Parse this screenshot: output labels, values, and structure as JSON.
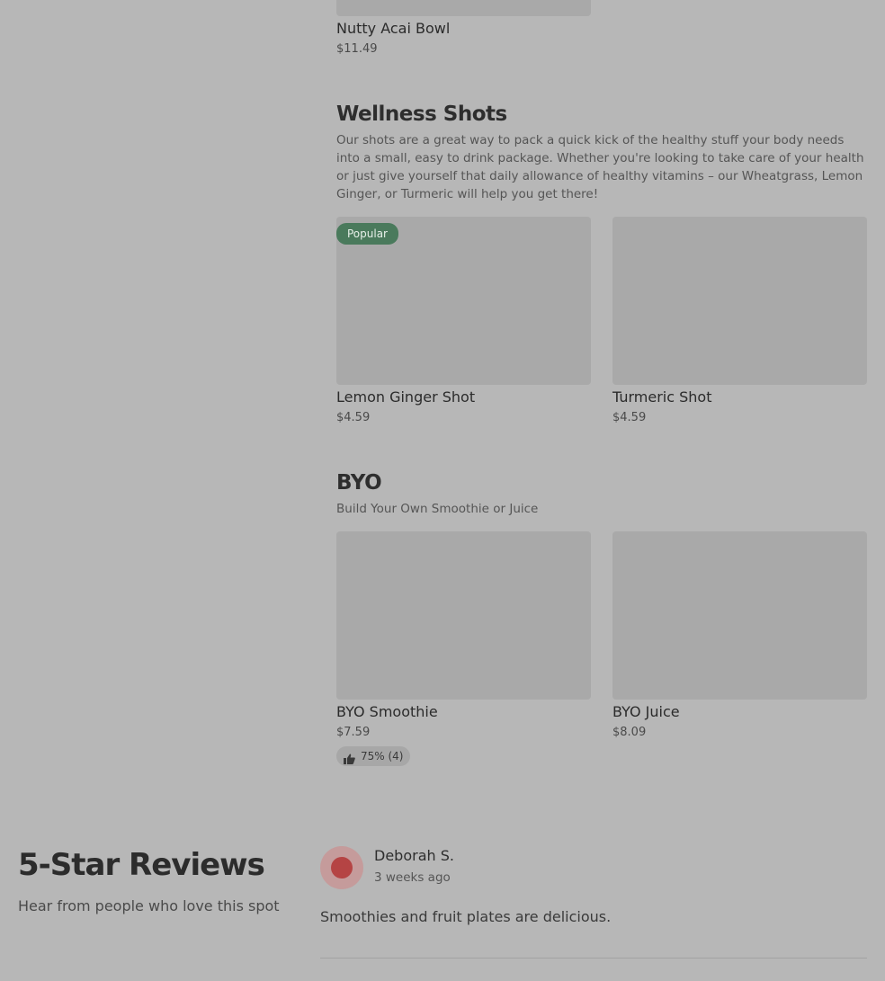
{
  "acai": {
    "item": {
      "name": "Nutty Acai Bowl",
      "price": "$11.49"
    }
  },
  "wellness": {
    "title": "Wellness Shots",
    "description": "Our shots are a great way to pack a quick kick of the healthy stuff your body needs into a small, easy to drink package. Whether you're looking to take care of your health or just give yourself that daily allowance of healthy vitamins – our Wheatgrass, Lemon Ginger, or Turmeric will help you get there!",
    "items": [
      {
        "name": "Lemon Ginger Shot",
        "price": "$4.59",
        "badge": "Popular"
      },
      {
        "name": "Turmeric Shot",
        "price": "$4.59"
      }
    ]
  },
  "byo": {
    "title": "BYO",
    "description": "Build Your Own Smoothie or Juice",
    "items": [
      {
        "name": "BYO Smoothie",
        "price": "$7.59",
        "rating": "75% (4)",
        "rating_icon": "thumbs-up-icon"
      },
      {
        "name": "BYO Juice",
        "price": "$8.09"
      }
    ]
  },
  "reviews": {
    "title": "5-Star Reviews",
    "subtitle": "Hear from people who love this spot",
    "items": [
      {
        "author": "Deborah S.",
        "time": "3 weeks ago",
        "text": "Smoothies and fruit plates are delicious."
      }
    ]
  }
}
